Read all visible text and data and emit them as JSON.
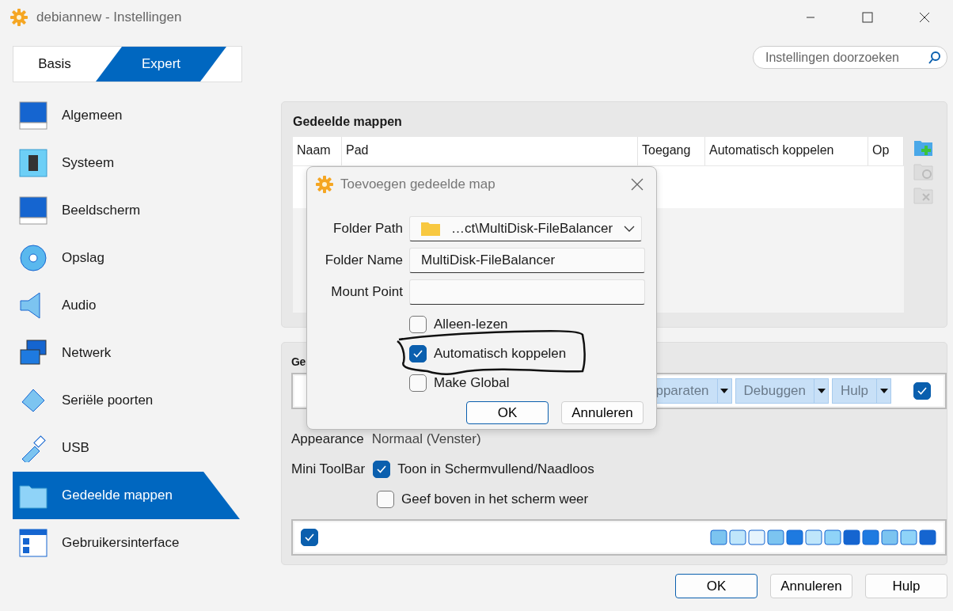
{
  "window": {
    "title": "debiannew - Instellingen"
  },
  "mode_tabs": [
    {
      "label": "Basis",
      "selected": false
    },
    {
      "label": "Expert",
      "selected": true
    }
  ],
  "search": {
    "placeholder": "Instellingen doorzoeken"
  },
  "sidebar": {
    "items": [
      {
        "label": "Algemeen",
        "selected": false
      },
      {
        "label": "Systeem",
        "selected": false
      },
      {
        "label": "Beeldscherm",
        "selected": false
      },
      {
        "label": "Opslag",
        "selected": false
      },
      {
        "label": "Audio",
        "selected": false
      },
      {
        "label": "Netwerk",
        "selected": false
      },
      {
        "label": "Seriële poorten",
        "selected": false
      },
      {
        "label": "USB",
        "selected": false
      },
      {
        "label": "Gedeelde mappen",
        "selected": true
      },
      {
        "label": "Gebruikersinterface",
        "selected": false
      }
    ]
  },
  "shared_folders": {
    "title": "Gedeelde mappen",
    "columns": [
      "Naam",
      "Pad",
      "Toegang",
      "Automatisch koppelen",
      "Op"
    ]
  },
  "ui_section": {
    "title": "Ge",
    "menu_items": [
      "pparaten",
      "Debuggen",
      "Hulp"
    ],
    "menubar_checked": true,
    "appearance": {
      "label": "Appearance",
      "value": "Normaal (Venster)"
    },
    "mini_toolbar": {
      "label": "Mini ToolBar",
      "options": [
        {
          "label": "Toon in Schermvullend/Naadloos",
          "checked": true
        },
        {
          "label": "Geef boven in het scherm weer",
          "checked": false
        }
      ]
    },
    "statusbar_checked": true
  },
  "dialog": {
    "title": "Toevoegen gedeelde map",
    "fields": [
      {
        "kind": "combo",
        "label": "Folder Path",
        "value": "…ct\\MultiDisk-FileBalancer"
      },
      {
        "kind": "text",
        "label": "Folder Name",
        "value": "MultiDisk-FileBalancer"
      },
      {
        "kind": "text",
        "label": "Mount Point"
      }
    ],
    "options": [
      {
        "label": "Alleen-lezen",
        "checked": false
      },
      {
        "label": "Automatisch koppelen",
        "checked": true
      },
      {
        "label": "Make Global",
        "checked": false
      }
    ],
    "buttons": [
      {
        "label": "OK",
        "default": true
      },
      {
        "label": "Annuleren",
        "default": false
      }
    ]
  },
  "buttons": [
    {
      "label": "OK",
      "default": true
    },
    {
      "label": "Annuleren",
      "default": false
    },
    {
      "label": "Hulp",
      "default": false
    }
  ]
}
